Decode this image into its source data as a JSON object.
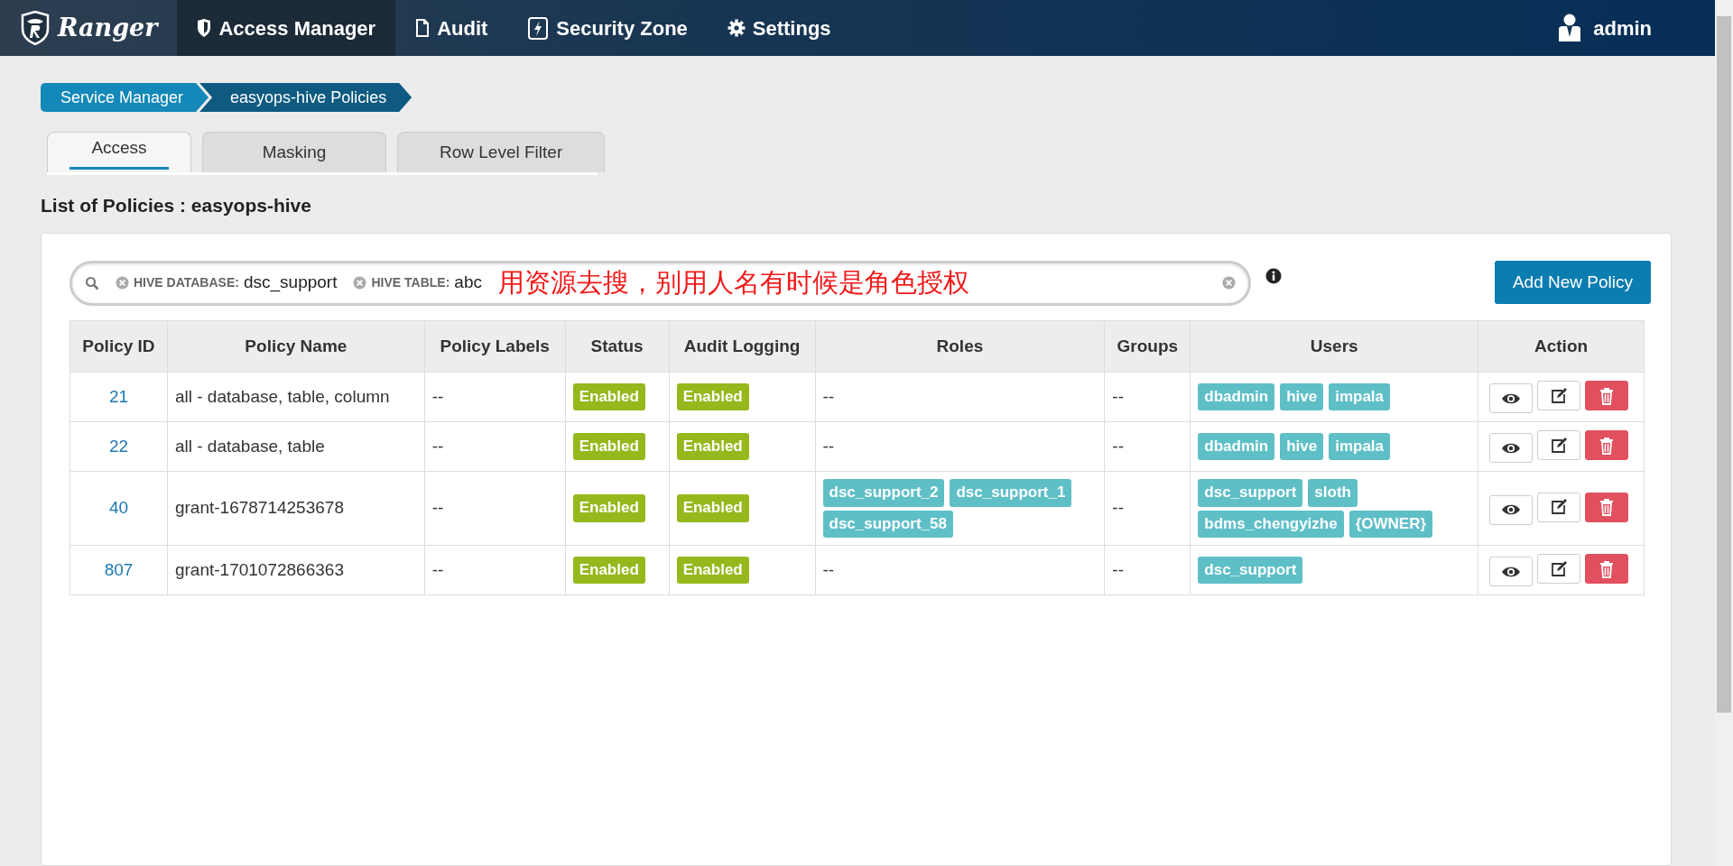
{
  "navbar": {
    "brand": "Ranger",
    "items": [
      {
        "label": "Access Manager",
        "selected": true
      },
      {
        "label": "Audit",
        "selected": false
      },
      {
        "label": "Security Zone",
        "selected": false
      },
      {
        "label": "Settings",
        "selected": false
      }
    ],
    "user": "admin"
  },
  "breadcrumb": [
    "Service Manager",
    "easyops-hive Policies"
  ],
  "tabs": [
    {
      "label": "Access",
      "selected": true
    },
    {
      "label": "Masking",
      "selected": false
    },
    {
      "label": "Row Level Filter",
      "selected": false
    }
  ],
  "heading": "List of Policies : easyops-hive",
  "search": {
    "filters": [
      {
        "label": "HIVE DATABASE:",
        "value": "dsc_support"
      },
      {
        "label": "HIVE TABLE:",
        "value": "abc"
      }
    ],
    "annotation": "用资源去搜，别用人名有时候是角色授权"
  },
  "add_button": "Add New Policy",
  "table": {
    "columns": [
      "Policy ID",
      "Policy Name",
      "Policy Labels",
      "Status",
      "Audit Logging",
      "Roles",
      "Groups",
      "Users",
      "Action"
    ],
    "rows": [
      {
        "id": "21",
        "name": "all - database, table, column",
        "labels": "--",
        "status": "Enabled",
        "audit_logging": "Enabled",
        "roles": "--",
        "groups": "--",
        "users": [
          "dbadmin",
          "hive",
          "impala"
        ]
      },
      {
        "id": "22",
        "name": "all - database, table",
        "labels": "--",
        "status": "Enabled",
        "audit_logging": "Enabled",
        "roles": "--",
        "groups": "--",
        "users": [
          "dbadmin",
          "hive",
          "impala"
        ]
      },
      {
        "id": "40",
        "name": "grant-1678714253678",
        "labels": "--",
        "status": "Enabled",
        "audit_logging": "Enabled",
        "roles": [
          "dsc_support_2",
          "dsc_support_1",
          "dsc_support_58"
        ],
        "groups": "--",
        "users": [
          "dsc_support",
          "sloth",
          "bdms_chengyizhe",
          "{OWNER}"
        ]
      },
      {
        "id": "807",
        "name": "grant-1701072866363",
        "labels": "--",
        "status": "Enabled",
        "audit_logging": "Enabled",
        "roles": "--",
        "groups": "--",
        "users": [
          "dsc_support"
        ]
      }
    ]
  }
}
